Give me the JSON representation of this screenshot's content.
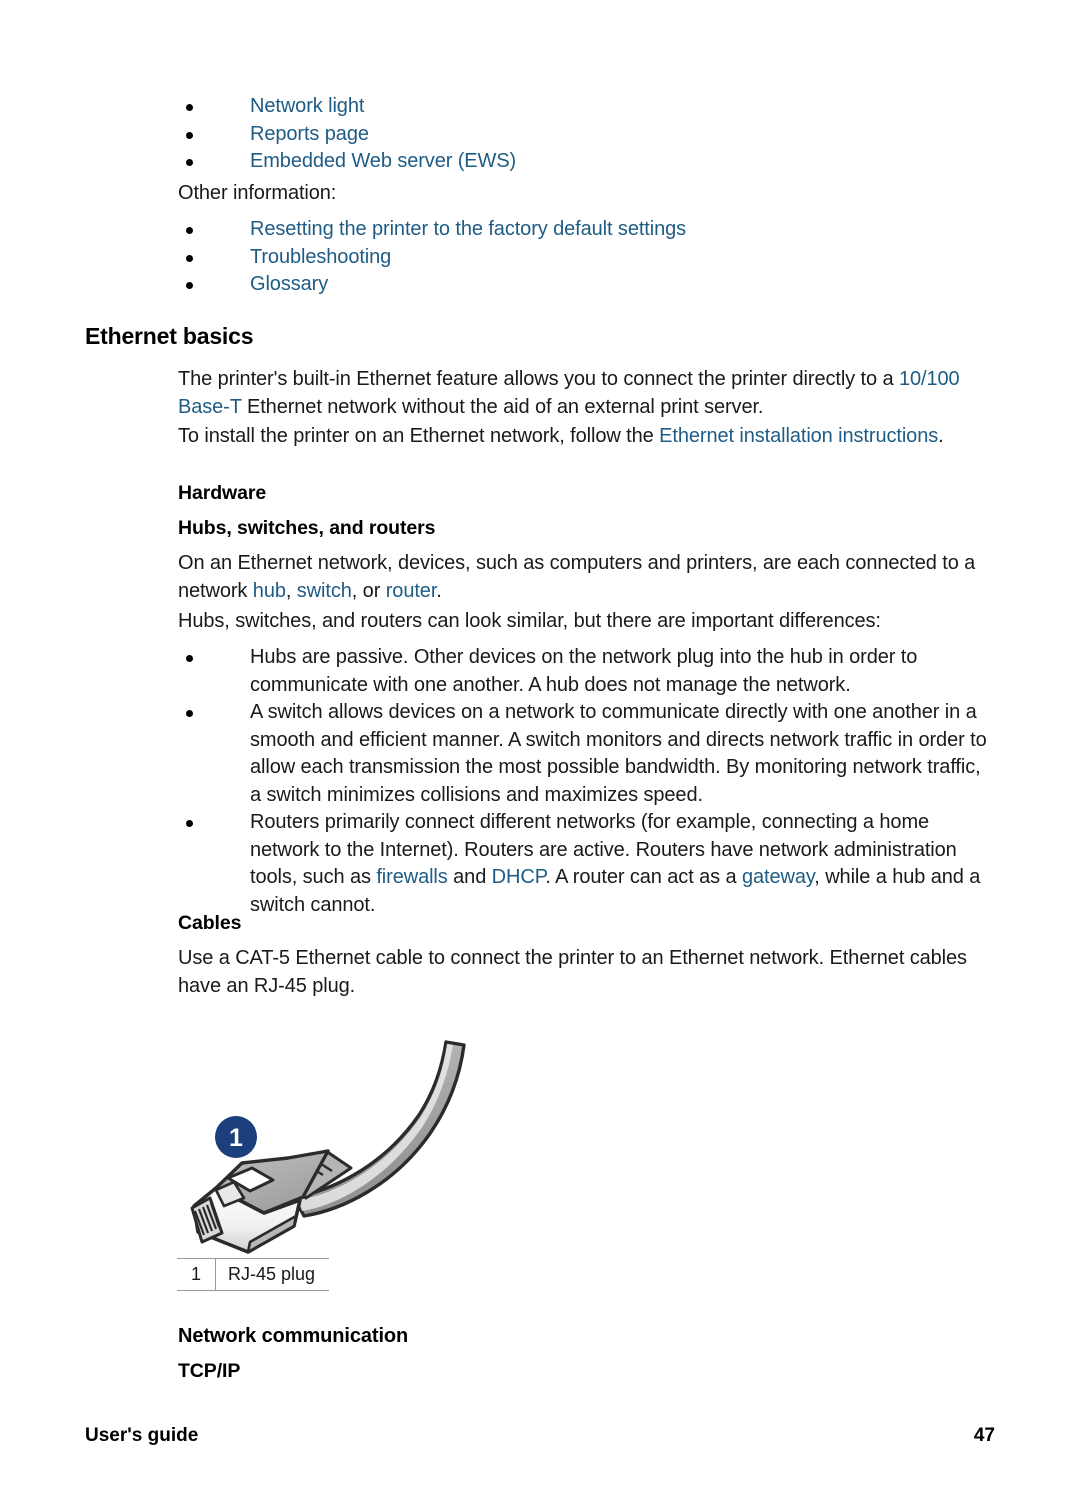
{
  "document": {
    "footer_left": "User's guide",
    "page_number": "47",
    "link_color": "#1f5c85",
    "callout_color": "#1b3f7a"
  },
  "top_links": {
    "items": [
      "Network light",
      "Reports page",
      "Embedded Web server (EWS)"
    ]
  },
  "other_information": {
    "label": "Other information:",
    "items": [
      "Resetting the printer to the factory default settings",
      "Troubleshooting",
      "Glossary"
    ]
  },
  "ethernet_basics": {
    "heading": "Ethernet basics",
    "para1_a": "The printer's built-in Ethernet feature allows you to connect the printer directly to a ",
    "para1_link": "10/100 Base-T",
    "para1_b": " Ethernet network without the aid of an external print server.",
    "para2_a": "To install the printer on an Ethernet network, follow the ",
    "para2_link": "Ethernet installation instructions",
    "para2_b": "."
  },
  "hardware": {
    "heading": "Hardware",
    "subheading": "Hubs, switches, and routers",
    "para1_a": "On an Ethernet network, devices, such as computers and printers, are each connected to a network ",
    "link_hub": "hub",
    "sep1": ", ",
    "link_switch": "switch",
    "sep2": ", or ",
    "link_router": "router",
    "para1_b": ".",
    "para2": "Hubs, switches, and routers can look similar, but there are important differences:",
    "bullets": {
      "hub": "Hubs are passive. Other devices on the network plug into the hub in order to communicate with one another. A hub does not manage the network.",
      "switch": "A switch allows devices on a network to communicate directly with one another in a smooth and efficient manner. A switch monitors and directs network traffic in order to allow each transmission the most possible bandwidth. By monitoring network traffic, a switch minimizes collisions and maximizes speed.",
      "router_a": "Routers primarily connect different networks (for example, connecting a home network to the Internet). Routers are active. Routers have network administration tools, such as ",
      "router_link_firewalls": "firewalls",
      "router_mid": " and ",
      "router_link_dhcp": "DHCP",
      "router_mid2": ". A router can act as a ",
      "router_link_gateway": "gateway",
      "router_b": ", while a hub and a switch cannot."
    }
  },
  "cables": {
    "heading": "Cables",
    "para": "Use a CAT-5 Ethernet cable to connect the printer to an Ethernet network. Ethernet cables have an RJ-45 plug.",
    "callout_number": "1",
    "legend": {
      "num": "1",
      "label": "RJ-45 plug"
    }
  },
  "network_communication": {
    "heading": "Network communication",
    "subheading": "TCP/IP"
  }
}
